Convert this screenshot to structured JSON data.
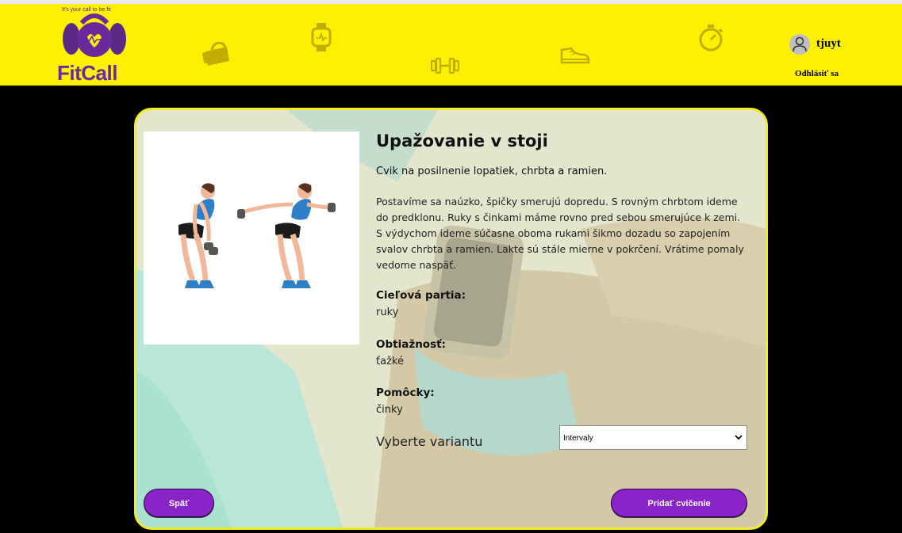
{
  "header": {
    "logo": {
      "tagline": "It's your call to be fit",
      "brand": "FitCall"
    },
    "nav_icons": [
      "gym-bag-icon",
      "smartwatch-icon",
      "dumbbell-icon",
      "sneaker-icon",
      "stopwatch-icon"
    ],
    "user": {
      "name": "tjuyt",
      "logout_label": "Odhlásiť sa"
    }
  },
  "exercise": {
    "title": "Upažovanie v stoji",
    "subtitle": "Cvik na posilnenie lopatiek, chrbta a ramien.",
    "description": "Postavíme sa naúzko, špičky smerujú dopredu. S rovným chrbtom ideme do predklonu. Ruky s činkami máme rovno pred sebou smerujúce k zemi. S výdychom ideme súčasne oboma rukami šikmo dozadu so zapojením svalov chrbta a ramien. Lakte sú stále mierne v pokrčení. Vrátime pomaly vedome naspäť.",
    "target_label": "Cieľová partia:",
    "target_value": "ruky",
    "difficulty_label": "Obtiažnosť:",
    "difficulty_value": "ťažké",
    "equipment_label": "Pomôcky:",
    "equipment_value": "činky",
    "variant_label": "Vyberte variantu",
    "variant_selected": "Intervaly"
  },
  "actions": {
    "back_label": "Späť",
    "add_label": "Pridať cvičenie"
  },
  "colors": {
    "header_bg": "#fdf000",
    "accent": "#8a23c8",
    "card_border": "#f3ec23",
    "brand": "#6a2a9b"
  }
}
